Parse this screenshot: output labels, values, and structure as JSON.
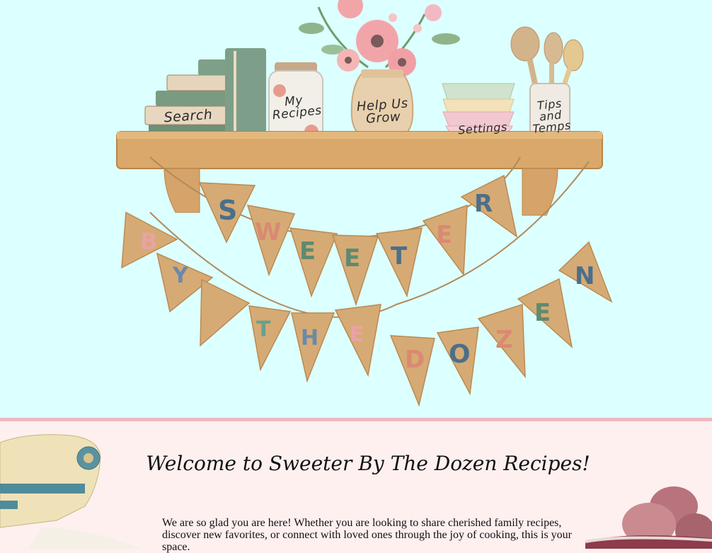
{
  "header": {
    "nav": {
      "search": "Search",
      "my_recipes_line1": "My",
      "my_recipes_line2": "Recipes",
      "help_line1": "Help Us",
      "help_line2": "Grow",
      "settings": "Settings",
      "tips_line1": "Tips",
      "tips_line2": "and",
      "tips_line3": "Temps"
    },
    "banner_top": [
      "S",
      "W",
      "E",
      "E",
      "T",
      "E",
      "R"
    ],
    "banner_bottom": [
      "B",
      "Y",
      "T",
      "H",
      "E",
      "D",
      "O",
      "Z",
      "E",
      "N"
    ]
  },
  "main": {
    "welcome_title": "Welcome to Sweeter By The Dozen Recipes!",
    "intro_text": "We are so glad you are here! Whether you are looking to share cherished family recipes, discover new favorites, or connect with loved ones through the joy of cooking, this is your space."
  },
  "colors": {
    "hero_bg": "#dcffff",
    "page_bg": "#fdf0ef",
    "divider": "#f0b8bf",
    "shelf": "#d9a86a",
    "burlap": "#d6aa74"
  }
}
